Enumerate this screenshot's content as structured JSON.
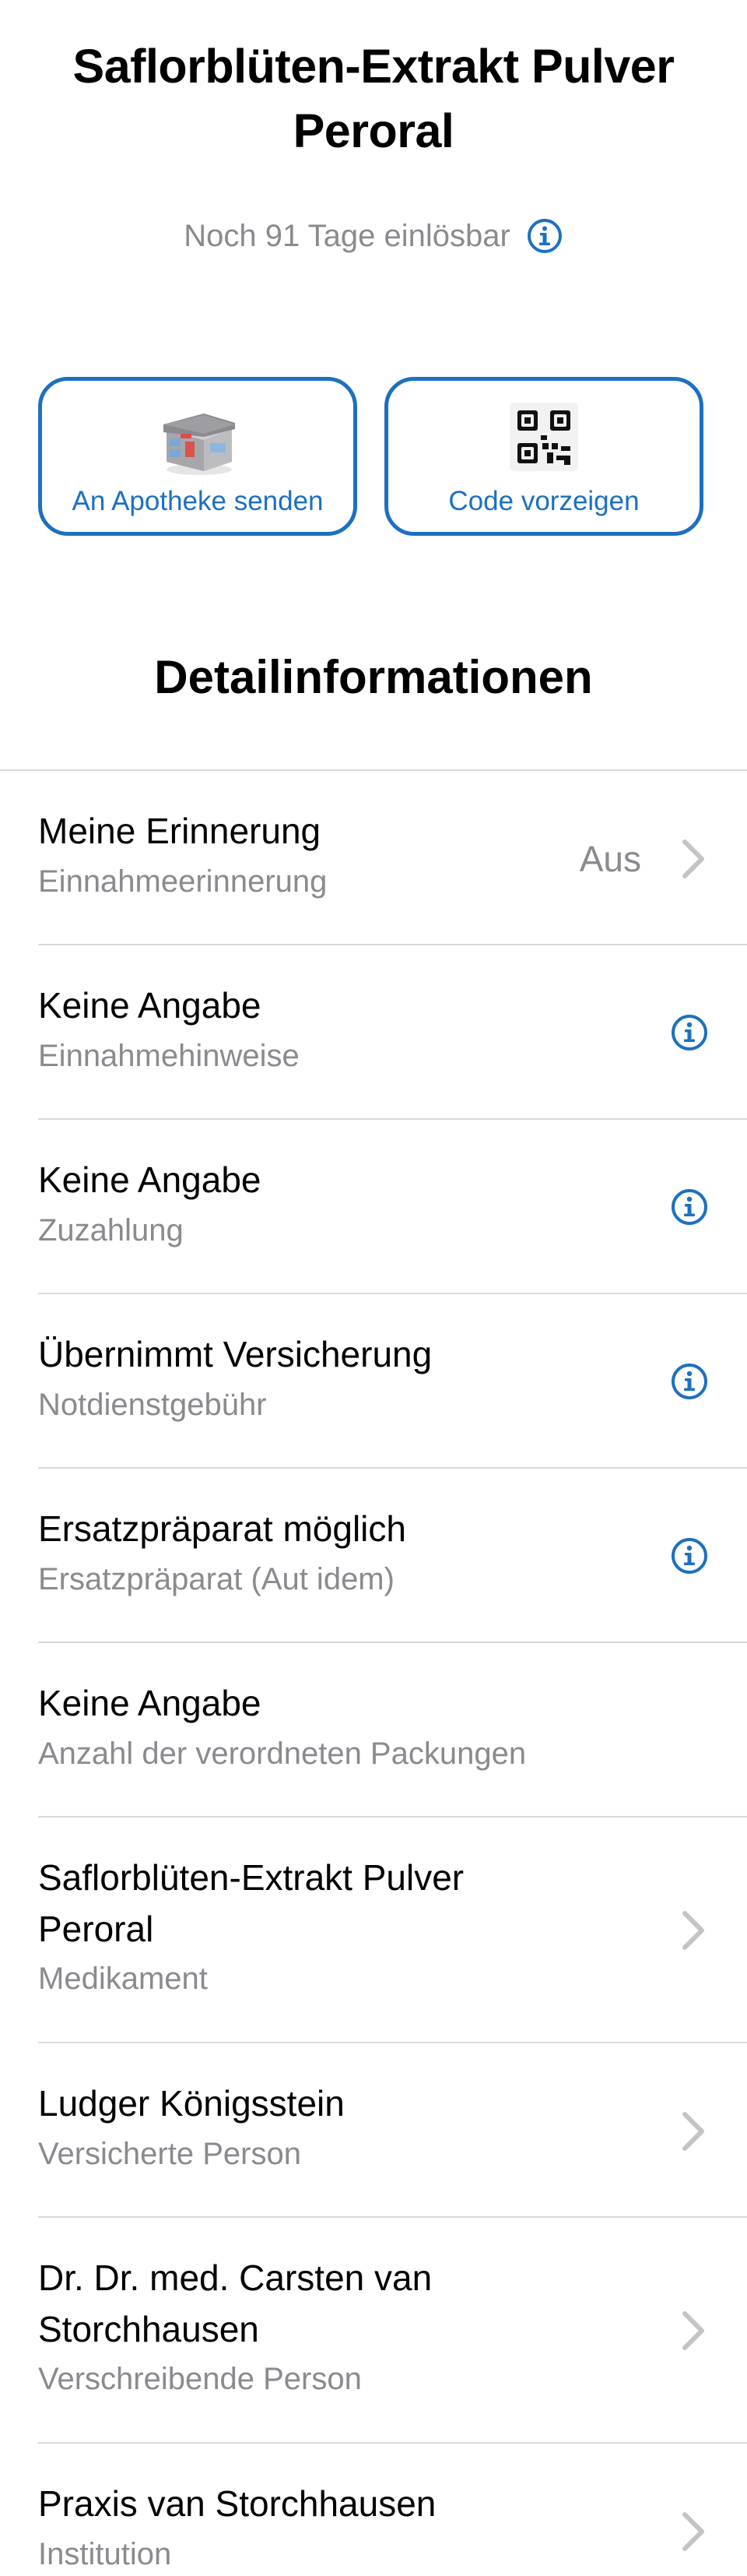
{
  "header": {
    "title_line1": "Saflorblüten-Extrakt Pulver",
    "title_line2": "Peroral",
    "validity_text": "Noch 91 Tage einlösbar",
    "validity_info_icon": "info-circle-icon"
  },
  "actions": [
    {
      "label": "An Apotheke senden",
      "icon": "pharmacy-building-icon"
    },
    {
      "label": "Code vorzeigen",
      "icon": "qr-code-icon"
    }
  ],
  "details": {
    "section_title": "Detailinformationen",
    "rows": [
      {
        "primary": "Meine Erinnerung",
        "secondary": "Einnahmeerinnerung",
        "value": "Aus",
        "accessory": "chevron"
      },
      {
        "primary": "Keine Angabe",
        "secondary": "Einnahmehinweise",
        "accessory": "info"
      },
      {
        "primary": "Keine Angabe",
        "secondary": "Zuzahlung",
        "accessory": "info"
      },
      {
        "primary": "Übernimmt Versicherung",
        "secondary": "Notdienstgebühr",
        "accessory": "info"
      },
      {
        "primary": "Ersatzpräparat möglich",
        "secondary": "Ersatzpräparat (Aut idem)",
        "accessory": "info"
      },
      {
        "primary": "Keine Angabe",
        "secondary": "Anzahl der verordneten Packungen",
        "accessory": "none"
      },
      {
        "primary_line1": "Saflorblüten-Extrakt Pulver",
        "primary_line2": "Peroral",
        "secondary": "Medikament",
        "accessory": "chevron"
      },
      {
        "primary": "Ludger Königsstein",
        "secondary": "Versicherte Person",
        "accessory": "chevron"
      },
      {
        "primary_line1": "Dr. Dr. med. Carsten van",
        "primary_line2": "Storchhausen",
        "secondary": "Verschreibende Person",
        "accessory": "chevron"
      },
      {
        "primary": "Praxis van Storchhausen",
        "secondary": "Institution",
        "accessory": "chevron"
      }
    ]
  },
  "colors": {
    "accent": "#1d70c0",
    "secondary_text": "#8a8a8f",
    "divider": "#d9d9dc",
    "chevron": "#c4c4c7"
  }
}
